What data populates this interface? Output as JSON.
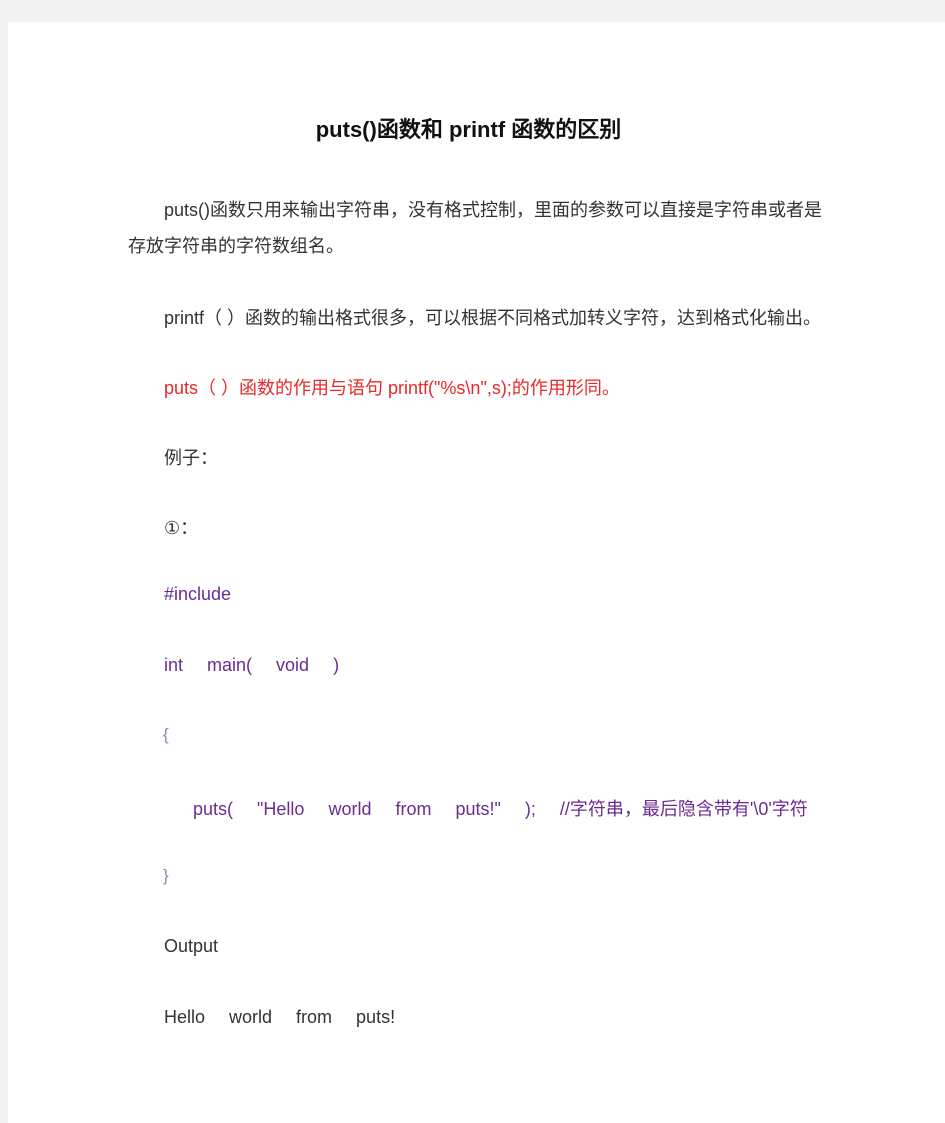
{
  "document": {
    "title": "puts()函数和 printf 函数的区别",
    "paragraphs": {
      "p1_line1": "puts()函数只用来输出字符串，没有格式控制，里面的参数可以直接是字符串或者是",
      "p1_line2": "存放字符串的字符数组名。",
      "p2": "printf（ ）函数的输出格式很多，可以根据不同格式加转义字符，达到格式化输出。",
      "p3_highlight": "puts（ ）函数的作用与语句 printf(\"%s\\n\",s);的作用形同。",
      "example_label": "例子：",
      "example_number": "①："
    },
    "code": {
      "include": "#include",
      "main_tokens": [
        "int",
        "main(",
        "void",
        ")"
      ],
      "open_brace": "{",
      "puts_tokens": [
        "puts(",
        "\"Hello",
        "world",
        "from",
        "puts!\"",
        ");"
      ],
      "comment": "//字符串，最后隐含带有'\\0'字符",
      "close_brace": "}"
    },
    "output_label": "Output",
    "output_tokens": [
      "Hello",
      "world",
      "from",
      "puts!"
    ]
  }
}
